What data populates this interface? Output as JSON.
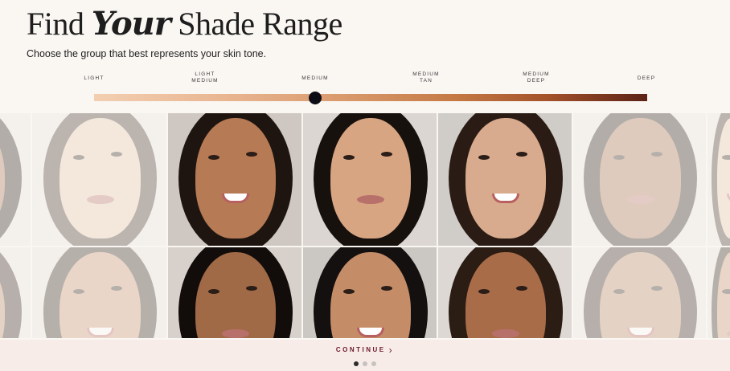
{
  "title": {
    "prefix": "Find",
    "script": "Your",
    "suffix": "Shade Range"
  },
  "subtitle": "Choose the group that best represents your skin tone.",
  "tones": [
    {
      "label": "LIGHT"
    },
    {
      "label": "LIGHT\nMEDIUM"
    },
    {
      "label": "MEDIUM"
    },
    {
      "label": "MEDIUM\nTAN"
    },
    {
      "label": "MEDIUM\nDEEP"
    },
    {
      "label": "DEEP"
    }
  ],
  "slider": {
    "selected": "MEDIUM",
    "value_fraction": 0.4
  },
  "tiles": [
    {
      "skin": "#e9c7ae",
      "hair": "#3a2a22",
      "bg": "#e8e2dd",
      "faded": true
    },
    {
      "skin": "#b67a55",
      "hair": "#1f1510",
      "bg": "#cfc7c1",
      "faded": false
    },
    {
      "skin": "#d8a583",
      "hair": "#17110e",
      "bg": "#dcd6d2",
      "faded": false
    },
    {
      "skin": "#d9ab8e",
      "hair": "#2a1c15",
      "bg": "#d0ccc8",
      "faded": false
    },
    {
      "skin": "#a8724f",
      "hair": "#1d130e",
      "bg": "#e8e2dd",
      "faded": true
    },
    {
      "skin": "#c9936f",
      "hair": "#2a1d16",
      "bg": "#e6e0db",
      "faded": true
    },
    {
      "skin": "#a06a47",
      "hair": "#120c0a",
      "bg": "#d8d1cb",
      "faded": false
    },
    {
      "skin": "#c48d67",
      "hair": "#151010",
      "bg": "#cbc7c3",
      "faded": false
    },
    {
      "skin": "#a86c49",
      "hair": "#2b1c14",
      "bg": "#ddd8d4",
      "faded": false
    },
    {
      "skin": "#b98763",
      "hair": "#2a1c16",
      "bg": "#e8e2dd",
      "faded": true
    }
  ],
  "footer": {
    "continue_label": "CONTINUE",
    "chevron": "›",
    "page_dots": 3,
    "active_dot": 0
  }
}
